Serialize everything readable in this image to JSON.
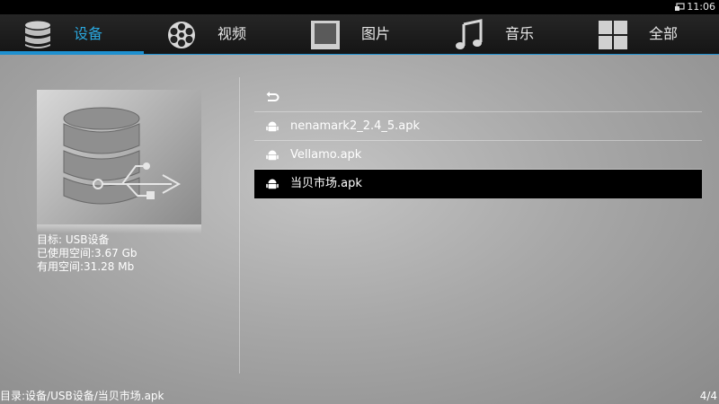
{
  "status_bar": {
    "time": "11:06",
    "icon": "cast-icon"
  },
  "tabs": [
    {
      "label": "设备",
      "icon": "database-icon",
      "active": true
    },
    {
      "label": "视频",
      "icon": "film-reel-icon",
      "active": false
    },
    {
      "label": "图片",
      "icon": "picture-frame-icon",
      "active": false
    },
    {
      "label": "音乐",
      "icon": "music-note-icon",
      "active": false
    },
    {
      "label": "全部",
      "icon": "grid-icon",
      "active": false
    }
  ],
  "device": {
    "image_icon": "usb-database-icon",
    "target": "目标: USB设备",
    "used": "已使用空间:3.67 Gb",
    "free": "有用空间:31.28 Mb"
  },
  "list": {
    "back_icon": "back-arrow-icon",
    "items": [
      {
        "label": "nenamark2_2.4_5.apk",
        "icon": "android-icon",
        "selected": false
      },
      {
        "label": "Vellamo.apk",
        "icon": "android-icon",
        "selected": false
      },
      {
        "label": "当贝市场.apk",
        "icon": "android-icon",
        "selected": true
      }
    ]
  },
  "footer": {
    "path": "目录:设备/USB设备/当贝市场.apk",
    "page": "4/4"
  },
  "colors": {
    "accent": "#1e90d0",
    "active_tab_text": "#2aa7de",
    "selected_row": "#000000"
  }
}
